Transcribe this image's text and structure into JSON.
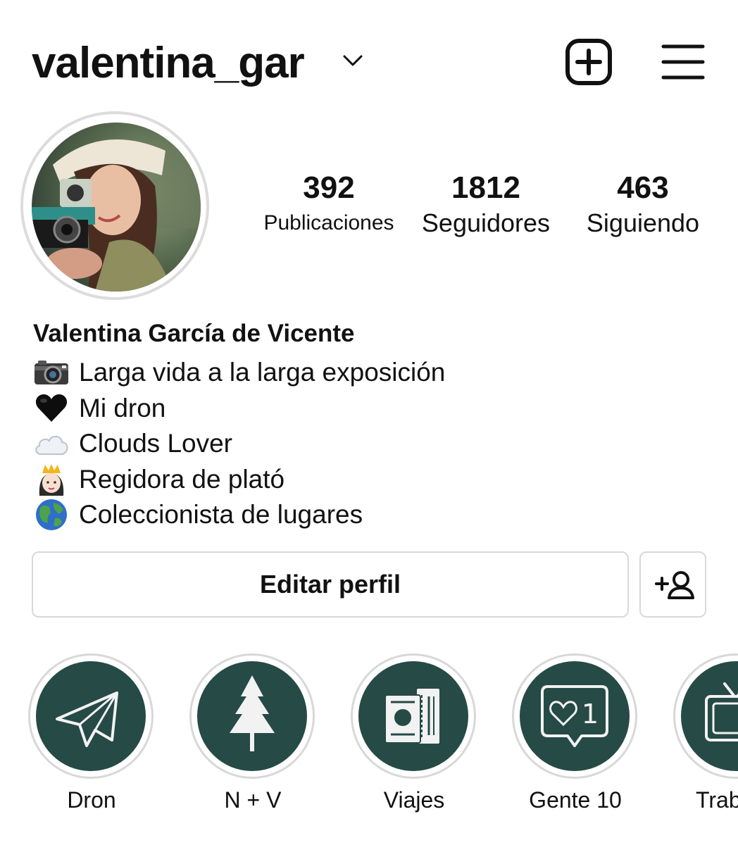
{
  "header": {
    "username": "valentina_gar",
    "icons": {
      "switch": "chevron-down-icon",
      "create": "plus-square-icon",
      "menu": "hamburger-menu-icon"
    }
  },
  "profile": {
    "avatar_icon": "profile-photo",
    "stats": [
      {
        "count": "392",
        "label": "Publicaciones"
      },
      {
        "count": "1812",
        "label": "Seguidores"
      },
      {
        "count": "463",
        "label": "Siguiendo"
      }
    ],
    "full_name": "Valentina García de Vicente",
    "bio": [
      {
        "icon": "camera-icon",
        "text": "Larga vida a la larga exposición"
      },
      {
        "icon": "black-heart-icon",
        "text": "Mi dron"
      },
      {
        "icon": "cloud-icon",
        "text": "Clouds Lover"
      },
      {
        "icon": "princess-icon",
        "text": "Regidora de plató"
      },
      {
        "icon": "globe-icon",
        "text": "Coleccionista de lugares"
      }
    ]
  },
  "actions": {
    "edit_label": "Editar perfil",
    "add_user_icon": "add-user-icon"
  },
  "highlights": [
    {
      "label": "Dron",
      "icon": "paper-plane-icon"
    },
    {
      "label": "N + V",
      "icon": "pine-tree-icon"
    },
    {
      "label": "Viajes",
      "icon": "passport-ticket-icon"
    },
    {
      "label": "Gente 10",
      "icon": "like-notification-icon",
      "badge": "1"
    },
    {
      "label": "Trab",
      "icon": "tv-icon"
    }
  ],
  "colors": {
    "highlight_bg": "#264a46",
    "border": "#d8d8d8",
    "text": "#111111"
  }
}
